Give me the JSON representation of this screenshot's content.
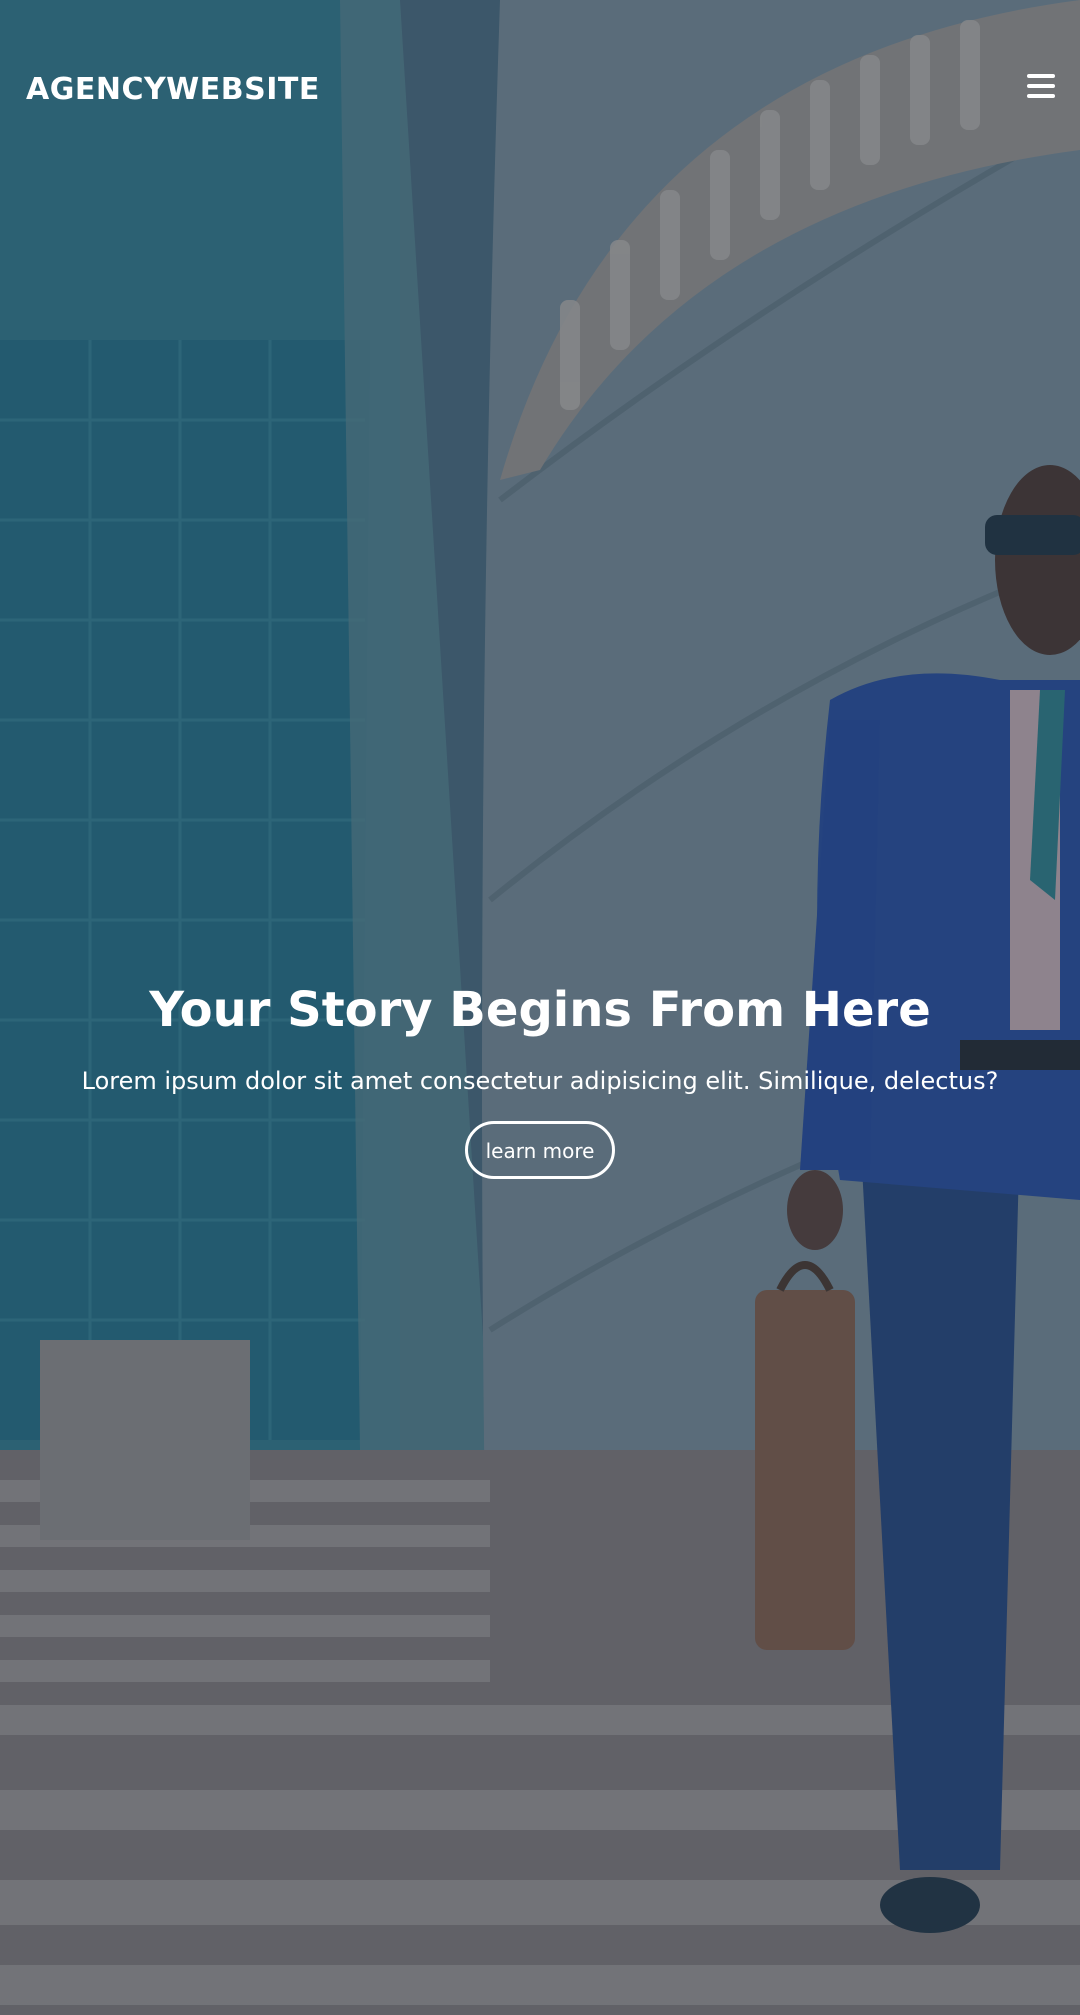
{
  "header": {
    "brand": "AGENCYWEBSITE",
    "menu_icon": "hamburger-menu-icon"
  },
  "hero": {
    "title": "Your Story Begins From Here",
    "subtitle": "Lorem ipsum dolor sit amet consectetur adipisicing elit. Similique, delectus?",
    "cta_label": "learn more",
    "background": "photo of man in blue suit with briefcase walking down stairs in front of glass building"
  },
  "colors": {
    "overlay": "#2a3e52",
    "text": "#ffffff"
  }
}
